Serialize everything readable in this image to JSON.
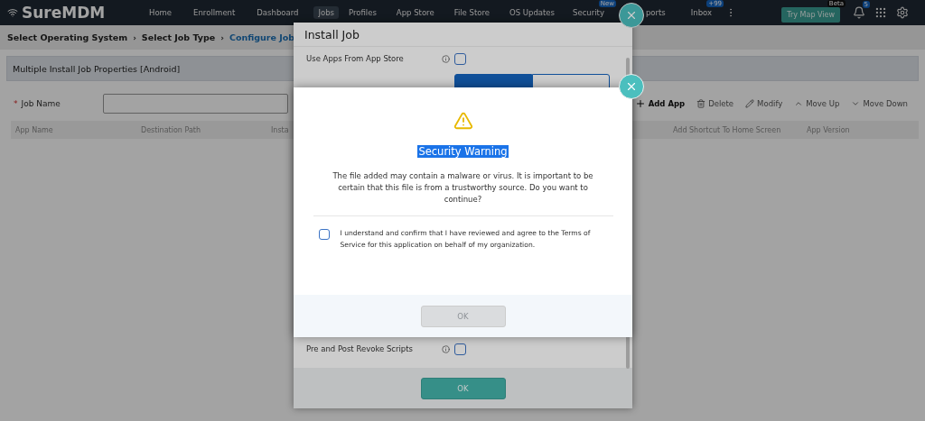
{
  "nav": {
    "logo": "SureMDM",
    "items": [
      {
        "label": "Home",
        "selected": false
      },
      {
        "label": "Enrollment",
        "selected": false
      },
      {
        "label": "Dashboard",
        "selected": false
      },
      {
        "label": "Jobs",
        "selected": true
      },
      {
        "label": "Profiles",
        "selected": false
      },
      {
        "label": "App Store",
        "selected": false
      },
      {
        "label": "File Store",
        "selected": false
      },
      {
        "label": "OS Updates",
        "selected": false
      },
      {
        "label": "Security",
        "selected": false,
        "badge": "New"
      },
      {
        "label": "ports",
        "selected": false
      },
      {
        "label": "Inbox",
        "selected": false,
        "badge": "+99"
      }
    ],
    "map_button": {
      "label": "Try Map View",
      "badge": "Beta"
    },
    "notifications": "5"
  },
  "breadcrumb_separator": "›",
  "breadcrumb": [
    {
      "label": "Select Operating System",
      "selected": false
    },
    {
      "label": "Select Job Type",
      "selected": false
    },
    {
      "label": "Configure Job",
      "selected": true
    }
  ],
  "panel": {
    "title": "Multiple Install Job Properties [Android]",
    "job_name": {
      "label": "Job Name",
      "required_mark": "*"
    },
    "toolbar": [
      "Add App",
      "Delete",
      "Modify",
      "Move Up",
      "Move Down"
    ],
    "columns": [
      "App Name",
      "Destination Path",
      "Insta",
      "Add Shortcut To Home Screen",
      "App Version"
    ]
  },
  "install_dialog": {
    "title": "Install Job",
    "use_app_store": {
      "label": "Use Apps From App Store",
      "checked": false
    },
    "source_toggle": [
      {
        "selected": true
      },
      {
        "selected": false
      }
    ],
    "revoke_scripts": {
      "label": "Pre and Post Revoke Scripts",
      "checked": false
    },
    "ok": "OK"
  },
  "warning": {
    "title": "Security Warning",
    "message": "The file added may contain a malware or virus. It is important to be certain that this file is from a trustworthy source. Do you want to continue?",
    "consent": {
      "label": "I understand and confirm that I have reviewed and agree to the Terms of Service for this application on behalf of my organization.",
      "checked": false
    },
    "ok": {
      "label": "OK",
      "disabled": true
    }
  }
}
